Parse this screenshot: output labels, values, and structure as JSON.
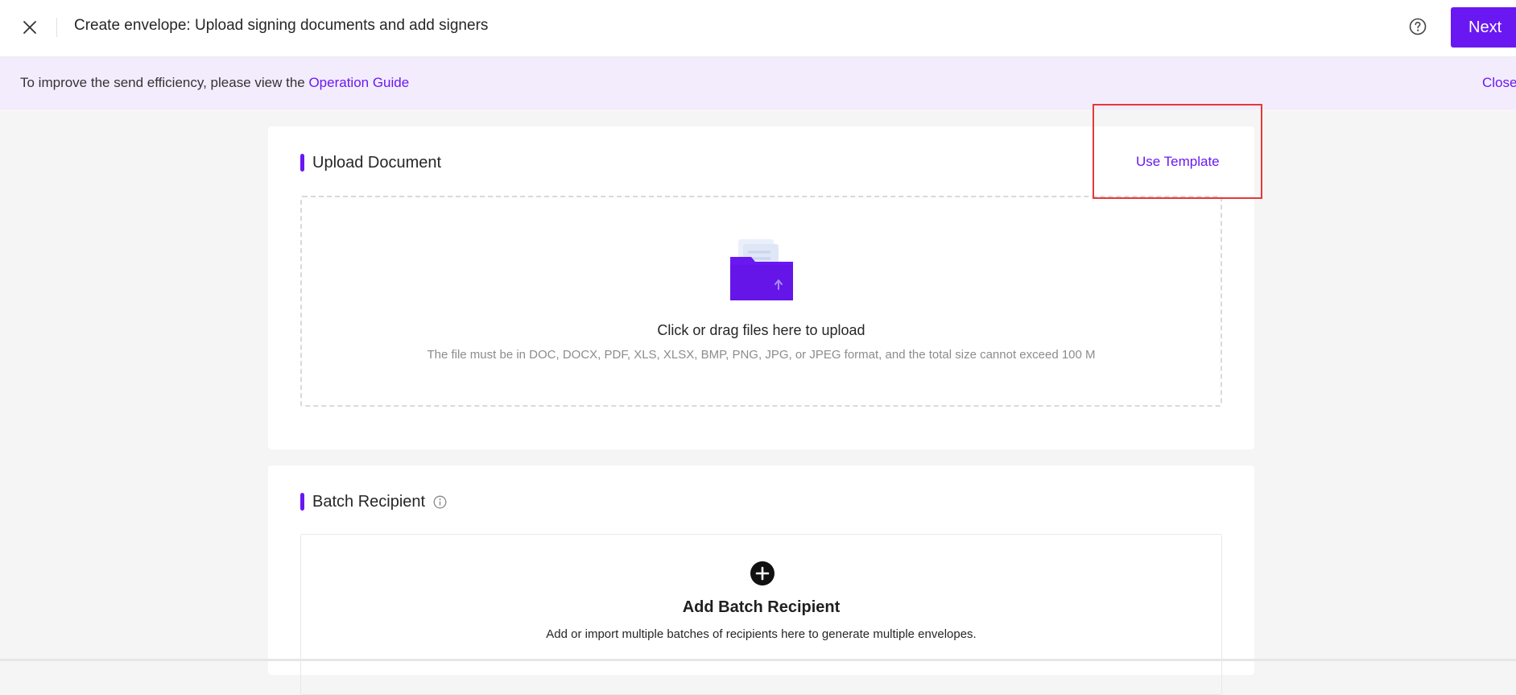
{
  "header": {
    "title": "Create envelope: Upload signing documents and add signers",
    "next_label": "Next",
    "icons": {
      "close": "close-icon",
      "help": "help-circle-icon"
    }
  },
  "banner": {
    "text": "To improve the send efficiency, please view the ",
    "link_label": "Operation Guide",
    "close_label": "Close"
  },
  "upload": {
    "title": "Upload Document",
    "use_template_label": "Use Template",
    "drop_title": "Click or drag files here to upload",
    "drop_hint": "The file must be in DOC, DOCX, PDF, XLS, XLSX, BMP, PNG, JPG, or JPEG format, and the total size cannot exceed 100 M",
    "icon": "folder-upload-icon"
  },
  "batch": {
    "title": "Batch Recipient",
    "add_title": "Add Batch Recipient",
    "add_subtitle": "Add or import multiple batches of recipients here to generate multiple envelopes.",
    "icons": {
      "info": "info-icon",
      "add": "plus-circle-icon"
    }
  },
  "colors": {
    "accent": "#6a18f2",
    "banner_bg": "#f3ecfd",
    "highlight": "#e53935"
  }
}
